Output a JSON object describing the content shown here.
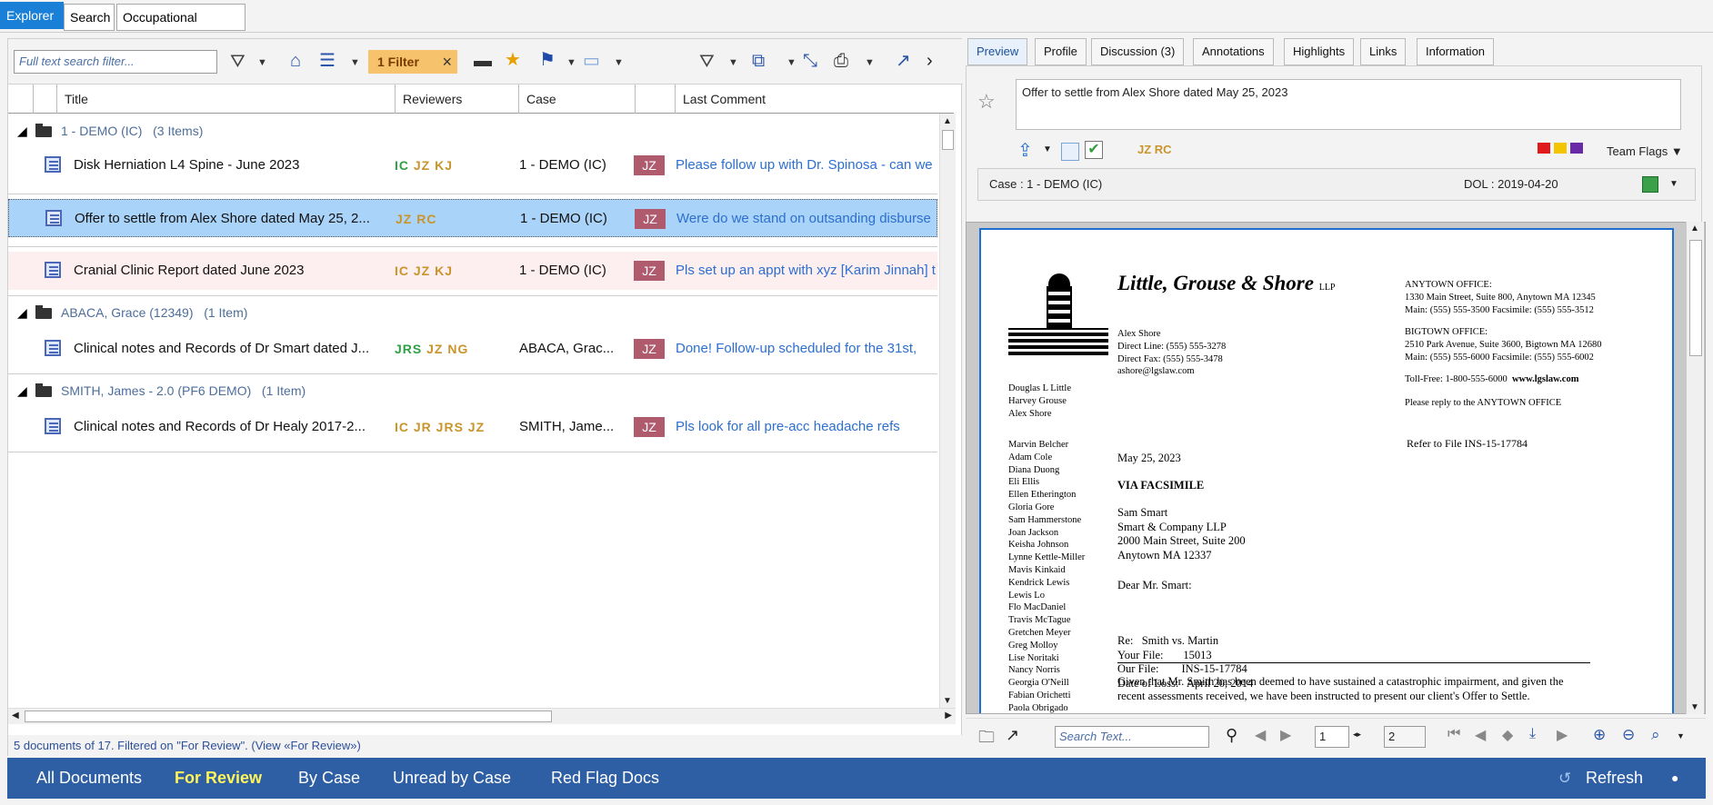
{
  "top_tabs": [
    "Explorer",
    "Search",
    "Occupational Thera..."
  ],
  "left": {
    "search_placeholder": "Full text search filter...",
    "filter_chip": "1 Filter",
    "columns": [
      "Title",
      "Reviewers",
      "Case",
      "Last Comment"
    ],
    "groups": [
      {
        "label": "1 - DEMO (IC)",
        "count": "(3 Items)"
      },
      {
        "label": "ABACA, Grace (12349)",
        "count": "(1 Item)"
      },
      {
        "label": "SMITH, James - 2.0 (PF6 DEMO)",
        "count": "(1 Item)"
      }
    ],
    "rows": [
      {
        "title": "Disk Herniation L4  Spine - June 2023",
        "reviewers": "IC JZ KJ",
        "case": "1 - DEMO (IC)",
        "badge": "JZ",
        "comment": "Please follow up with Dr. Spinosa - can we"
      },
      {
        "title": "Offer to settle from Alex Shore dated May 25, 2...",
        "reviewers": "JZ RC",
        "case": "1 - DEMO (IC)",
        "badge": "JZ",
        "comment": "Were do we stand on outsanding disburse"
      },
      {
        "title": "Cranial Clinic  Report dated June 2023",
        "reviewers": "IC JZ KJ",
        "case": "1 - DEMO (IC)",
        "badge": "JZ",
        "comment": "Pls set up an appt with xyz [Karim Jinnah] t"
      },
      {
        "title": "Clinical notes and Records of Dr Smart dated J...",
        "reviewers": "JRS JZ NG",
        "case": "ABACA,  Grac...",
        "badge": "JZ",
        "comment": "Done!  Follow-up scheduled for the 31st,"
      },
      {
        "title": "Clinical notes and Records of Dr Healy 2017-2...",
        "reviewers": "IC JR JRS JZ",
        "case": "SMITH, Jame...",
        "badge": "JZ",
        "comment": "Pls look for all pre-acc headache refs"
      }
    ],
    "status": "5 documents of 17.  Filtered on \"For Review\". (View «For Review»)"
  },
  "bottom": {
    "items": [
      "All Documents",
      "For Review",
      "By Case",
      "Unread by Case",
      "Red Flag Docs"
    ],
    "active": "For Review",
    "refresh": "Refresh"
  },
  "right": {
    "tabs": [
      "Preview",
      "Profile",
      "Discussion (3)",
      "Annotations",
      "Highlights",
      "Links",
      "Information"
    ],
    "doc_title": "Offer to settle from Alex Shore dated May 25, 2023",
    "reviewers": "JZ RC",
    "team_flags": "Team Flags",
    "case": "Case : 1 - DEMO (IC)",
    "dol": "DOL : 2019-04-20",
    "search_placeholder": "Search Text...",
    "page_current": "1",
    "page_total": "2"
  },
  "letter": {
    "firm": "Little, Grouse & Shore",
    "llp": "LLP",
    "sender": [
      "Alex Shore",
      "Direct Line: (555) 555-3278",
      "Direct Fax: (555) 555-3478",
      "ashore@lgslaw.com"
    ],
    "anytown": [
      "ANYTOWN OFFICE:",
      "1330 Main Street, Suite 800, Anytown MA 12345",
      "Main: (555) 555-3500   Facsimile:  (555) 555-3512"
    ],
    "bigtown": [
      "BIGTOWN OFFICE:",
      "2510 Park Avenue, Suite 3600, Bigtown MA 12680",
      "Main: (555) 555-6000   Facsimile:  (555) 555-6002"
    ],
    "tollfree": "Toll-Free:  1-800-555-6000",
    "web": "www.lgslaw.com",
    "reply": "Please reply to the ANYTOWN OFFICE",
    "partners": [
      "Douglas L Little",
      "Harvey Grouse",
      "Alex Shore"
    ],
    "associates": [
      "Marvin Belcher",
      "Adam Cole",
      "Diana Duong",
      "Eli Ellis",
      "Ellen Etherington",
      "Gloria Gore",
      "Sam Hammerstone",
      "Joan Jackson",
      "Keisha Johnson",
      "Lynne Kettle-Miller",
      "Mavis Kinkaid",
      "Kendrick Lewis",
      "Lewis Lo",
      "Flo MacDaniel",
      "Travis McTague",
      "Gretchen Meyer",
      "Greg Molloy",
      "Lise Noritaki",
      "Nancy Norris",
      "Georgia O'Neill",
      "Fabian Orichetti",
      "Paola Obrigado"
    ],
    "refer": "Refer to File INS-15-17784",
    "date": "May 25, 2023",
    "via": "VIA FACSIMILE",
    "recipient": [
      "Sam Smart",
      "Smart & Company LLP",
      "2000 Main Street, Suite 200",
      "Anytown MA 12337"
    ],
    "salutation": "Dear Mr. Smart:",
    "re": [
      "Re:   Smith vs. Martin",
      "Your File:       15013",
      "Our File:        INS-15-17784",
      "Date of Loss:   April 20, 2014"
    ],
    "body": "Given that Mr. Smith has been deemed to have sustained a catastrophic impairment, and given the recent assessments received, we have been instructed to present our client's Offer to Settle."
  }
}
